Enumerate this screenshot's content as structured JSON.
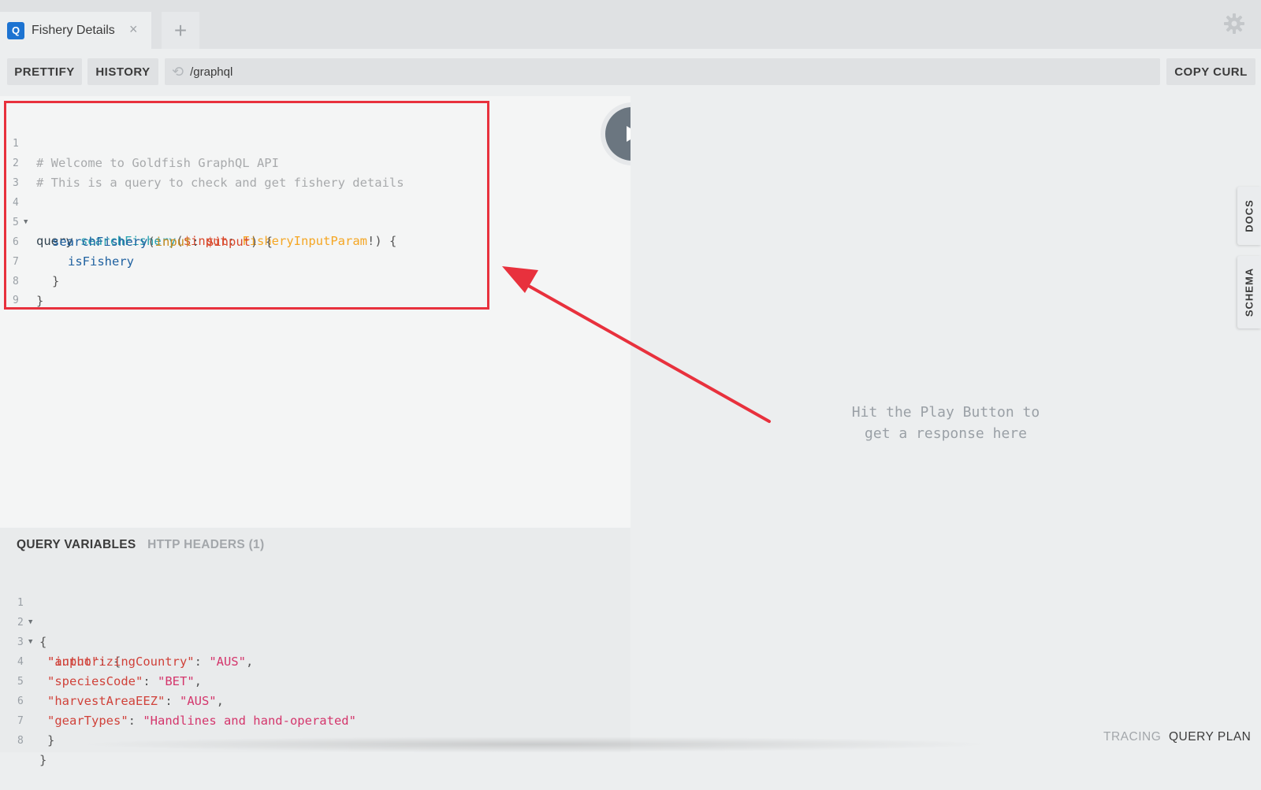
{
  "tabs": [
    {
      "badge": "Q",
      "title": "Fishery Details",
      "close": "×"
    }
  ],
  "add_tab_label": "+",
  "toolbar": {
    "prettify_label": "PRETTIFY",
    "history_label": "HISTORY",
    "url": "/graphql",
    "copy_curl_label": "COPY CURL"
  },
  "editor": {
    "line_numbers": [
      "1",
      "2",
      "3",
      "4",
      "5",
      "6",
      "7",
      "8",
      "9"
    ],
    "comment1": "# Welcome to Goldfish GraphQL API",
    "comment2": "# This is a query to check and get fishery details",
    "kw_query": "query",
    "op_name": "searchFishery",
    "paren_open": "(",
    "var_input": "$input",
    "colon_space": ": ",
    "type_name": "FisheryInputParam",
    "bang_brace": "!) {",
    "field_search": "searchFishery",
    "arg_input": "input",
    "arg_colon": ": ",
    "arg_var": "$input",
    "arg_close": ") {",
    "field_is_fishery": "isFishery",
    "close_inner": "}",
    "close_outer": "}"
  },
  "result": {
    "hint_line1": "Hit the Play Button to",
    "hint_line2": "get a response here"
  },
  "side_tabs": {
    "docs": "DOCS",
    "schema": "SCHEMA"
  },
  "variables_pane": {
    "tab_query_variables": "QUERY VARIABLES",
    "tab_http_headers": "HTTP HEADERS (1)",
    "line_numbers": [
      "1",
      "2",
      "3",
      "4",
      "5",
      "6",
      "7",
      "8"
    ],
    "open_brace": "{",
    "key_input": "\"input\"",
    "input_tail": ": {",
    "key_authorizing_country": "\"authorizingCountry\"",
    "val_authorizing_country": "\"AUS\"",
    "key_species_code": "\"speciesCode\"",
    "val_species_code": "\"BET\"",
    "key_harvest_area": "\"harvestAreaEEZ\"",
    "val_harvest_area": "\"AUS\"",
    "key_gear_types": "\"gearTypes\"",
    "val_gear_types": "\"Handlines and hand-operated\"",
    "close_inner": "}",
    "close_outer": "}"
  },
  "footer": {
    "tracing": "TRACING",
    "query_plan": "QUERY PLAN"
  },
  "colors": {
    "annotation_red": "#e8313d",
    "badge_blue": "#1d73d1",
    "play_button": "#6b7680"
  },
  "icons": [
    "graphql-q-icon",
    "close-icon",
    "plus-icon",
    "gear-icon",
    "reload-icon",
    "play-icon",
    "fold-arrow-icon"
  ]
}
